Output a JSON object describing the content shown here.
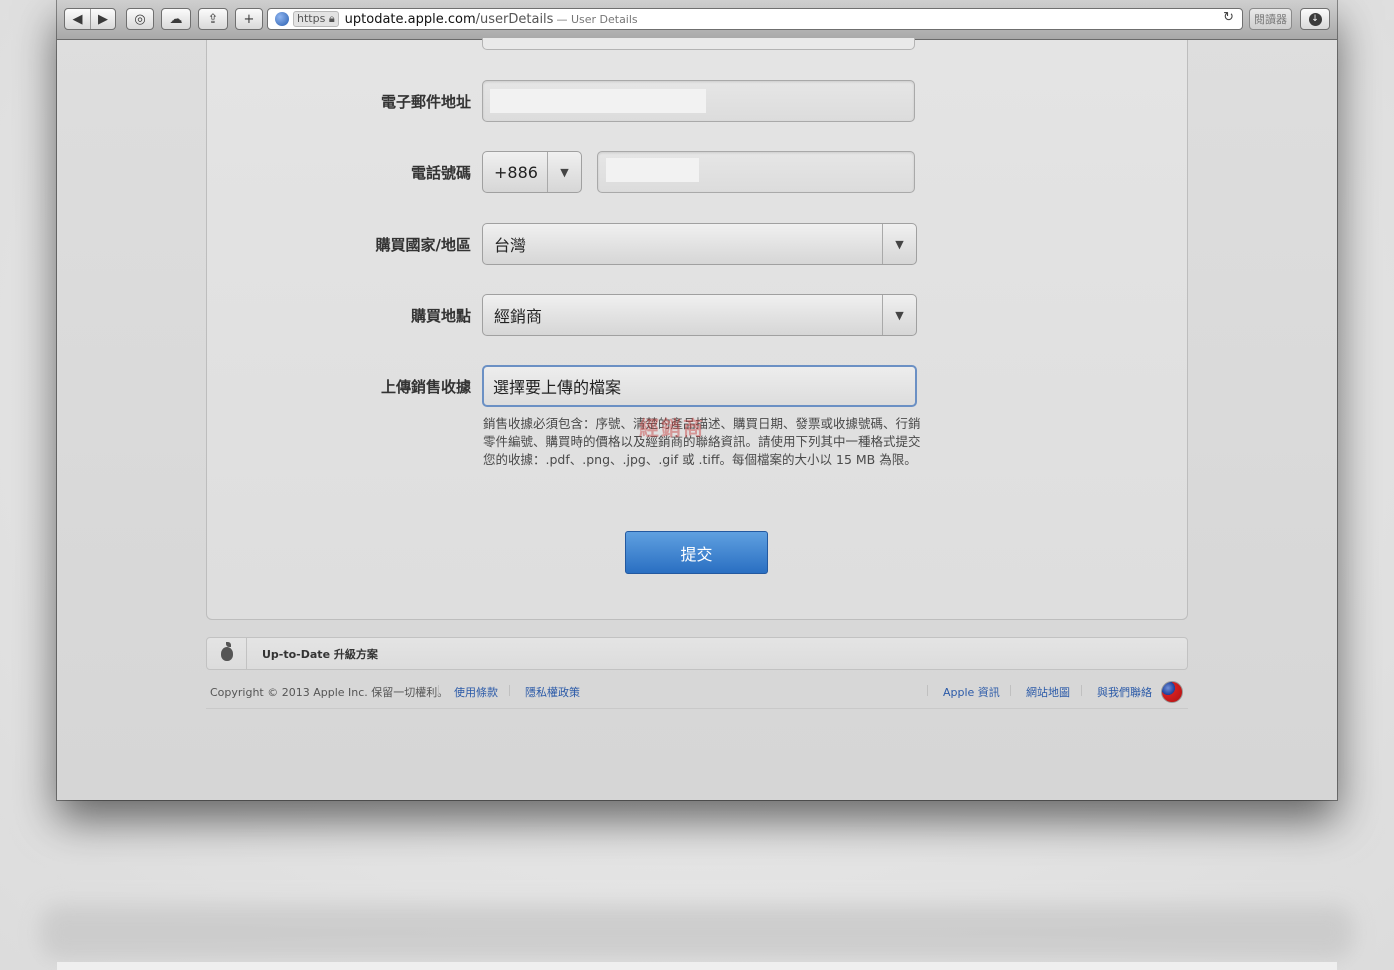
{
  "browser": {
    "url_scheme": "https",
    "url_host": "uptodate.apple.com",
    "url_path": "/userDetails",
    "page_title": "— User Details",
    "reader_label": "閱讀器",
    "add_tab_label": "+"
  },
  "form": {
    "email_label": "電子郵件地址",
    "phone_label": "電話號碼",
    "country_code": "+886",
    "country_label": "購買國家/地區",
    "country_value": "台灣",
    "purchase_place_label": "購買地點",
    "purchase_place_value": "經銷商",
    "receipt_label": "上傳銷售收據",
    "receipt_value": "選擇要上傳的檔案",
    "help_text": "銷售收據必須包含：序號、清楚的產品描述、購買日期、發票或收據號碼、行銷零件編號、購買時的價格以及經銷商的聯絡資訊。請使用下列其中一種格式提交您的收據：.pdf、.png、.jpg、.gif 或 .tiff。每個檔案的大小以 15 MB 為限。",
    "submit_label": "提交",
    "watermark": "經銷商"
  },
  "footer": {
    "breadcrumb": "Up-to-Date 升級方案",
    "copyright": "Copyright © 2013 Apple Inc. 保留一切權利。",
    "links_left": [
      "使用條款",
      "隱私權政策"
    ],
    "links_right": [
      "Apple 資訊",
      "網站地圖",
      "與我們聯絡"
    ]
  },
  "colors": {
    "submit_button": "#2a6fc2",
    "link": "#2b5aa8",
    "file_box_border": "#6b90c4"
  },
  "icons": [
    "back-icon",
    "forward-icon",
    "history-icon",
    "icloud-icon",
    "share-icon",
    "globe-icon",
    "lock-icon",
    "reload-icon",
    "download-icon",
    "apple-icon",
    "flag-icon",
    "dropdown-arrow-icon"
  ]
}
